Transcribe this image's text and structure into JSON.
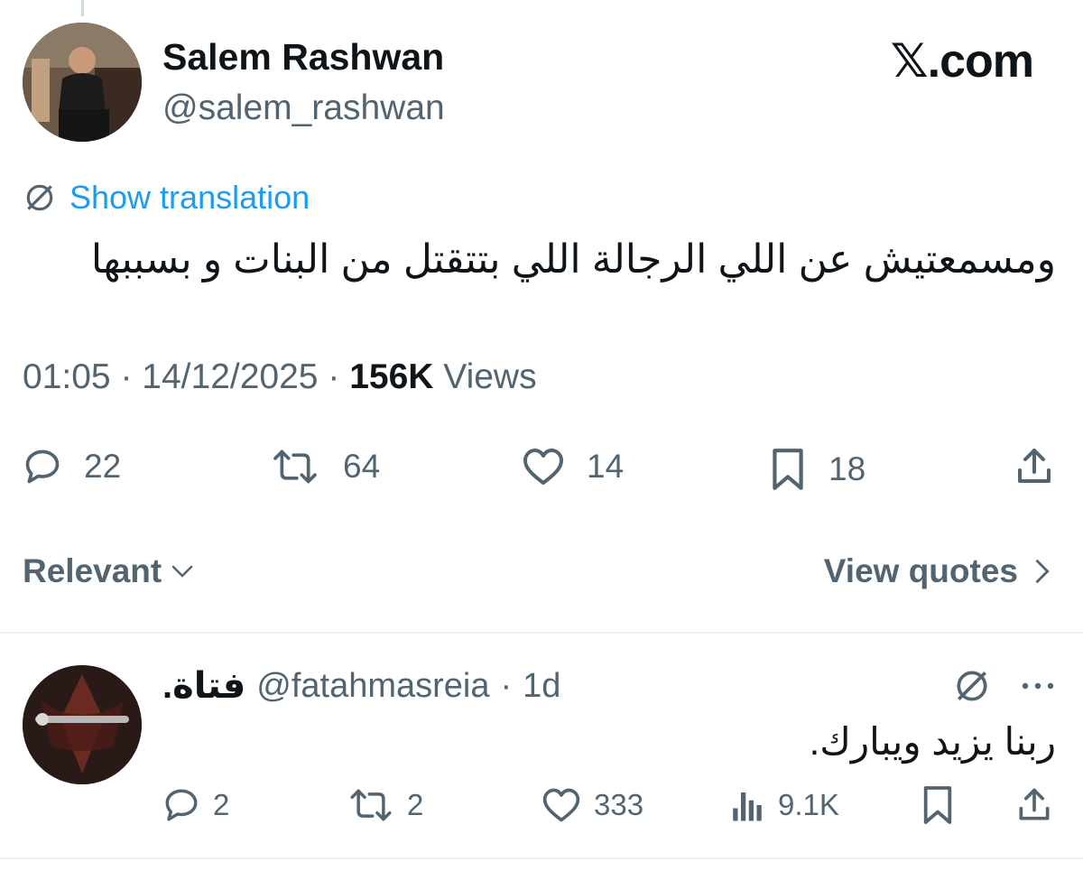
{
  "tweet": {
    "author_name": "Salem Rashwan",
    "author_handle": "@salem_rashwan",
    "brand": "𝕏.com",
    "show_translation": "Show translation",
    "text": "ومسمعتيش عن اللي الرجالة اللي بتتقتل من البنات و بسببها",
    "time": "01:05",
    "date": "14/12/2025",
    "views_count": "156K",
    "views_label": "Views",
    "separator": "·",
    "stats": {
      "replies": "22",
      "reposts": "64",
      "likes": "14",
      "bookmarks": "18"
    }
  },
  "sort": {
    "label": "Relevant",
    "view_quotes": "View quotes"
  },
  "reply": {
    "author_name": "فتاة.",
    "author_handle": "@fatahmasreia",
    "separator": "·",
    "age": "1d",
    "text": "ربنا يزيد ويبارك.",
    "stats": {
      "replies": "2",
      "reposts": "2",
      "likes": "333",
      "views": "9.1K"
    }
  },
  "colors": {
    "accent": "#1d9bf0",
    "text_primary": "#0f1419",
    "text_secondary": "#536471",
    "divider": "#eff3f4"
  }
}
